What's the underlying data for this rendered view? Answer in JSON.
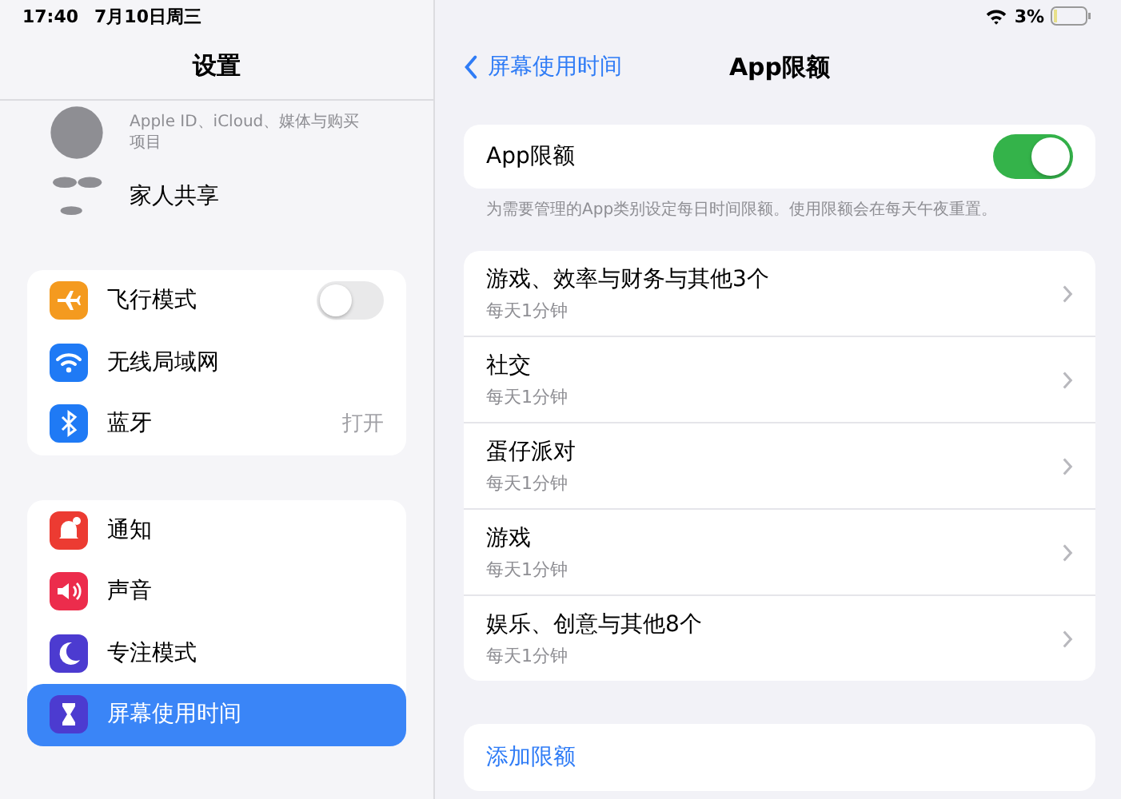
{
  "status_bar": {
    "time": "17:40",
    "date": "7月10日周三",
    "battery": "3%"
  },
  "sidebar": {
    "title": "设置",
    "profile": {
      "subtitle": "Apple ID、iCloud、媒体与购买项目"
    },
    "family": {
      "label": "家人共享"
    },
    "groups": [
      [
        {
          "kind": "toggle",
          "label": "飞行模式",
          "on": false,
          "selected": false,
          "color": "#f49a1f"
        },
        {
          "kind": "plain",
          "label": "无线局域网",
          "selected": false,
          "color": "#1f7af5"
        },
        {
          "kind": "value",
          "label": "蓝牙",
          "value": "打开",
          "selected": false,
          "color": "#1f7af5"
        }
      ],
      [
        {
          "kind": "plain",
          "label": "通知",
          "selected": false,
          "color": "#ec3b32"
        },
        {
          "kind": "plain",
          "label": "声音",
          "selected": false,
          "color": "#ec2c4c"
        },
        {
          "kind": "plain",
          "label": "专注模式",
          "selected": false,
          "color": "#4c3bd0"
        },
        {
          "kind": "plain",
          "label": "屏幕使用时间",
          "selected": true,
          "color": "#4c3bd0"
        }
      ]
    ]
  },
  "nav": {
    "back": "屏幕使用时间",
    "title": "App限额"
  },
  "limits_toggle": {
    "label": "App限额",
    "on": true
  },
  "footnote": "为需要管理的App类别设定每日时间限额。使用限额会在每天午夜重置。",
  "limits": [
    {
      "name": "游戏、效率与财务与其他3个",
      "time": "每天1分钟"
    },
    {
      "name": "社交",
      "time": "每天1分钟"
    },
    {
      "name": "蛋仔派对",
      "time": "每天1分钟"
    },
    {
      "name": "游戏",
      "time": "每天1分钟"
    },
    {
      "name": "娱乐、创意与其他8个",
      "time": "每天1分钟"
    }
  ],
  "add_button": "添加限额"
}
